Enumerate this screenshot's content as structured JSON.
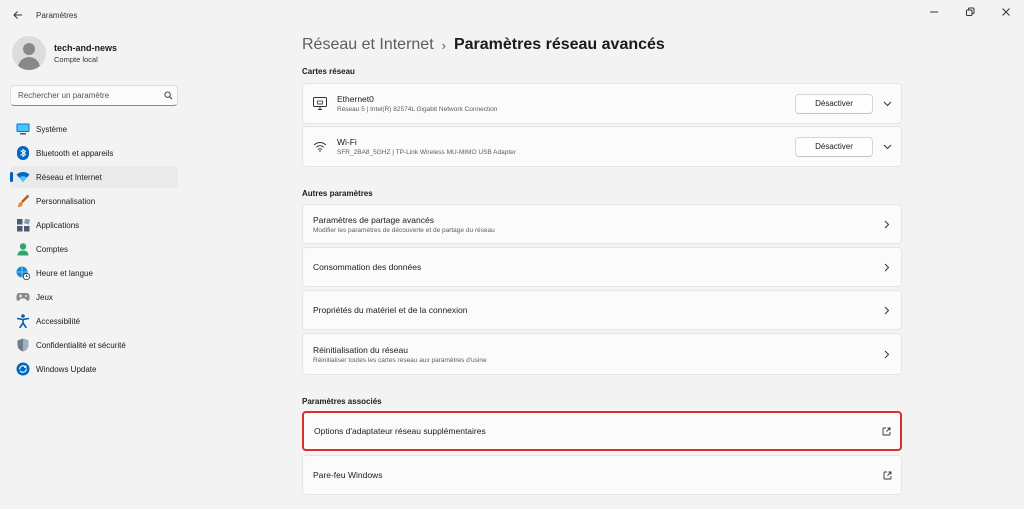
{
  "window": {
    "title": "Paramètres",
    "back_icon": "back-arrow-icon",
    "controls": [
      "minimize-icon",
      "restore-icon",
      "close-icon"
    ]
  },
  "profile": {
    "name": "tech-and-news",
    "account_type": "Compte local"
  },
  "search": {
    "placeholder": "Rechercher un paramètre",
    "value": ""
  },
  "sidebar": {
    "items": [
      {
        "label": "Système",
        "icon": "system-icon",
        "color": "#0078d4"
      },
      {
        "label": "Bluetooth et appareils",
        "icon": "bluetooth-icon",
        "color": "#0067c0"
      },
      {
        "label": "Réseau et Internet",
        "icon": "wifi-icon",
        "color": "#0067c0",
        "active": true
      },
      {
        "label": "Personnalisation",
        "icon": "paintbrush-icon",
        "color": "#e8833a"
      },
      {
        "label": "Applications",
        "icon": "apps-icon",
        "color": "#4a5a73"
      },
      {
        "label": "Comptes",
        "icon": "person-icon",
        "color": "#2ea56a"
      },
      {
        "label": "Heure et langue",
        "icon": "globe-clock-icon",
        "color": "#1a8ad4"
      },
      {
        "label": "Jeux",
        "icon": "gamepad-icon",
        "color": "#7a7a7a"
      },
      {
        "label": "Accessibilité",
        "icon": "accessibility-icon",
        "color": "#0a5cad"
      },
      {
        "label": "Confidentialité et sécurité",
        "icon": "shield-icon",
        "color": "#6e7b8b"
      },
      {
        "label": "Windows Update",
        "icon": "update-icon",
        "color": "#0067c0"
      }
    ]
  },
  "breadcrumb": {
    "parent": "Réseau et Internet",
    "separator": "›",
    "current": "Paramètres réseau avancés"
  },
  "sections": {
    "adapters": "Cartes réseau",
    "other": "Autres paramètres",
    "related": "Paramètres associés"
  },
  "adapters": [
    {
      "name": "Ethernet0",
      "description": "Réseau 5 | Intel(R) 82574L Gigabit Network Connection",
      "button": "Désactiver",
      "icon": "ethernet-icon"
    },
    {
      "name": "Wi-Fi",
      "description": "SFR_2BA8_5GHZ | TP-Link Wireless MU-MIMO USB Adapter",
      "button": "Désactiver",
      "icon": "wifi-icon"
    }
  ],
  "other_settings": [
    {
      "title": "Paramètres de partage avancés",
      "subtitle": "Modifier les paramètres de découverte et de partage du réseau"
    },
    {
      "title": "Consommation des données",
      "subtitle": ""
    },
    {
      "title": "Propriétés du matériel et de la connexion",
      "subtitle": ""
    },
    {
      "title": "Réinitialisation du réseau",
      "subtitle": "Réinitialiser toutes les cartes réseau aux paramètres d'usine"
    }
  ],
  "related_settings": [
    {
      "title": "Options d'adaptateur réseau supplémentaires",
      "highlighted": true,
      "icon": "external-link-icon"
    },
    {
      "title": "Pare-feu Windows",
      "highlighted": false,
      "icon": "external-link-icon"
    }
  ],
  "colors": {
    "accent": "#005fb8",
    "highlight_border": "#d9302c",
    "background": "#f3f3f3",
    "card": "#fbfbfb"
  }
}
